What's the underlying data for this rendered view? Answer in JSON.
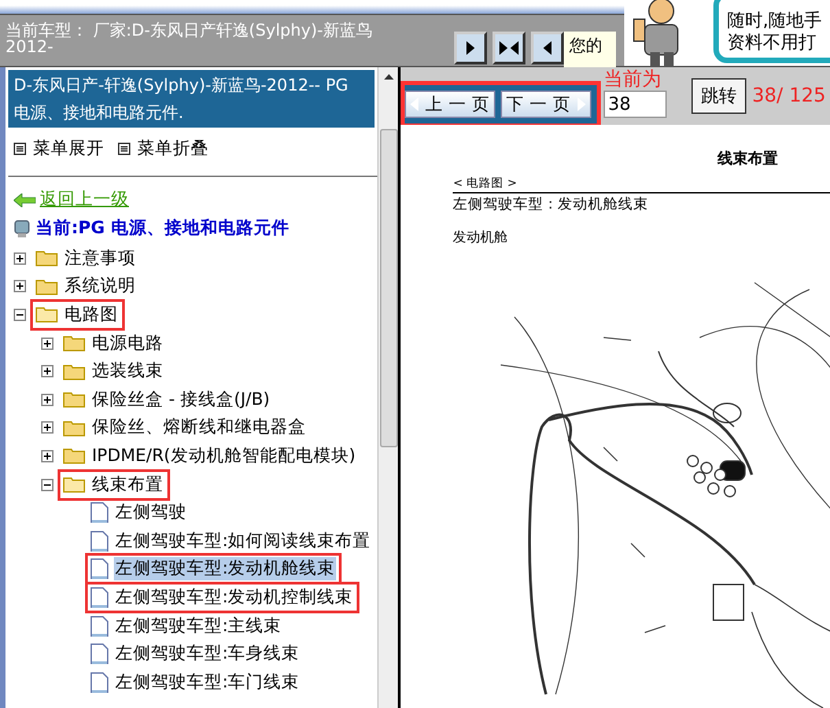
{
  "header": {
    "car_model": "当前车型： 厂家:D-东风日产轩逸(Sylphy)-新蓝鸟",
    "car_model_cut": "2012-",
    "notice": "您的",
    "ad_lines": [
      "随时,随地手",
      "资料不用打"
    ]
  },
  "sidebar": {
    "title": "D-东风日产-轩逸(Sylphy)-新蓝鸟-2012-- PG 电源、接地和电路元件.",
    "expand_all": "菜单展开",
    "collapse_all": "菜单折叠",
    "back_link": "返回上一级",
    "current": "当前:PG 电源、接地和电路元件",
    "tree": [
      {
        "label": "注意事项",
        "kind": "folder",
        "expanded": false,
        "outlined": false
      },
      {
        "label": "系统说明",
        "kind": "folder",
        "expanded": false,
        "outlined": false
      },
      {
        "label": "电路图",
        "kind": "folder",
        "expanded": true,
        "outlined": true,
        "children": [
          {
            "label": "电源电路",
            "kind": "folder",
            "expanded": false,
            "outlined": false
          },
          {
            "label": "选装线束",
            "kind": "folder",
            "expanded": false,
            "outlined": false
          },
          {
            "label": "保险丝盒 - 接线盒(J/B)",
            "kind": "folder",
            "expanded": false,
            "outlined": false
          },
          {
            "label": "保险丝、熔断线和继电器盒",
            "kind": "folder",
            "expanded": false,
            "outlined": false
          },
          {
            "label": "IPDME/R(发动机舱智能配电模块)",
            "kind": "folder",
            "expanded": false,
            "outlined": false
          },
          {
            "label": "线束布置",
            "kind": "folder",
            "expanded": true,
            "outlined": true,
            "children": [
              {
                "label": "左侧驾驶",
                "kind": "page",
                "selected": false,
                "outlined": false
              },
              {
                "label": "左侧驾驶车型:如何阅读线束布置",
                "kind": "page",
                "selected": false,
                "outlined": false
              },
              {
                "label": "左侧驾驶车型:发动机舱线束",
                "kind": "page",
                "selected": true,
                "outlined": true
              },
              {
                "label": "左侧驾驶车型:发动机控制线束",
                "kind": "page",
                "selected": false,
                "outlined": true
              },
              {
                "label": "左侧驾驶车型:主线束",
                "kind": "page",
                "selected": false,
                "outlined": false
              },
              {
                "label": "左侧驾驶车型:车身线束",
                "kind": "page",
                "selected": false,
                "outlined": false
              },
              {
                "label": "左侧驾驶车型:车门线束",
                "kind": "page",
                "selected": false,
                "outlined": false
              }
            ]
          }
        ]
      }
    ]
  },
  "pager": {
    "prev": "上 一 页",
    "next": "下 一 页",
    "current_label": "当前为",
    "page_value": "38",
    "go": "跳转",
    "count": "38/ 125"
  },
  "document": {
    "title": "线束布置",
    "section": "< 电路图 >",
    "subtitle": "左侧驾驶车型 : 发动机舱线束",
    "area": "发动机舱"
  }
}
